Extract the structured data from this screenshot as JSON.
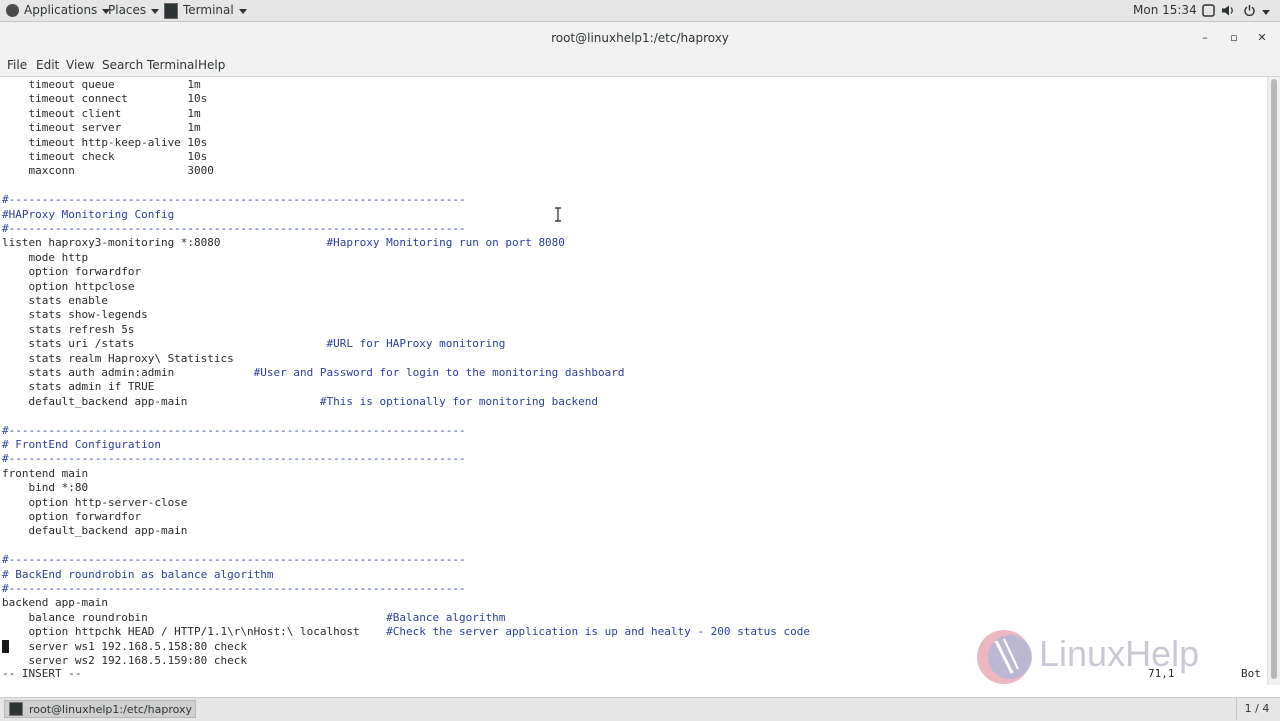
{
  "panel": {
    "applications_label": "Applications",
    "places_label": "Places",
    "taskbar_app_label": "Terminal",
    "clock": "Mon 15:34"
  },
  "window": {
    "title": "root@linuxhelp1:/etc/haproxy",
    "minimize": "–",
    "maximize": "▫",
    "close": "✕"
  },
  "menubar": {
    "items": [
      "File",
      "Edit",
      "View",
      "Search",
      "Terminal",
      "Help"
    ]
  },
  "terminal": {
    "lines": [
      {
        "code": "    timeout queue           1m",
        "comment": ""
      },
      {
        "code": "    timeout connect         10s",
        "comment": ""
      },
      {
        "code": "    timeout client          1m",
        "comment": ""
      },
      {
        "code": "    timeout server          1m",
        "comment": ""
      },
      {
        "code": "    timeout http-keep-alive 10s",
        "comment": ""
      },
      {
        "code": "    timeout check           10s",
        "comment": ""
      },
      {
        "code": "    maxconn                 3000",
        "comment": ""
      },
      {
        "code": "",
        "comment": ""
      },
      {
        "code": "",
        "comment": "#---------------------------------------------------------------------"
      },
      {
        "code": "",
        "comment": "#HAProxy Monitoring Config"
      },
      {
        "code": "",
        "comment": "#---------------------------------------------------------------------"
      },
      {
        "code": "listen haproxy3-monitoring *:8080                ",
        "comment": "#Haproxy Monitoring run on port 8080"
      },
      {
        "code": "    mode http",
        "comment": ""
      },
      {
        "code": "    option forwardfor",
        "comment": ""
      },
      {
        "code": "    option httpclose",
        "comment": ""
      },
      {
        "code": "    stats enable",
        "comment": ""
      },
      {
        "code": "    stats show-legends",
        "comment": ""
      },
      {
        "code": "    stats refresh 5s",
        "comment": ""
      },
      {
        "code": "    stats uri /stats                             ",
        "comment": "#URL for HAProxy monitoring"
      },
      {
        "code": "    stats realm Haproxy\\ Statistics",
        "comment": ""
      },
      {
        "code": "    stats auth admin:admin            ",
        "comment": "#User and Password for login to the monitoring dashboard"
      },
      {
        "code": "    stats admin if TRUE",
        "comment": ""
      },
      {
        "code": "    default_backend app-main                    ",
        "comment": "#This is optionally for monitoring backend"
      },
      {
        "code": "",
        "comment": ""
      },
      {
        "code": "",
        "comment": "#---------------------------------------------------------------------"
      },
      {
        "code": "",
        "comment": "# FrontEnd Configuration"
      },
      {
        "code": "",
        "comment": "#---------------------------------------------------------------------"
      },
      {
        "code": "frontend main",
        "comment": ""
      },
      {
        "code": "    bind *:80",
        "comment": ""
      },
      {
        "code": "    option http-server-close",
        "comment": ""
      },
      {
        "code": "    option forwardfor",
        "comment": ""
      },
      {
        "code": "    default_backend app-main",
        "comment": ""
      },
      {
        "code": "",
        "comment": ""
      },
      {
        "code": "",
        "comment": "#---------------------------------------------------------------------"
      },
      {
        "code": "",
        "comment": "# BackEnd roundrobin as balance algorithm"
      },
      {
        "code": "",
        "comment": "#---------------------------------------------------------------------"
      },
      {
        "code": "backend app-main",
        "comment": ""
      },
      {
        "code": "    balance roundrobin                                    ",
        "comment": "#Balance algorithm"
      },
      {
        "code": "    option httpchk HEAD / HTTP/1.1\\r\\nHost:\\ localhost    ",
        "comment": "#Check the server application is up and healty - 200 status code"
      },
      {
        "code": "    server ws1 192.168.5.158:80 check",
        "comment": ""
      },
      {
        "code": "    server ws2 192.168.5.159:80 check",
        "comment": ""
      }
    ],
    "mode_line": "-- INSERT --",
    "cursor_pos": "71,1",
    "scroll_pos": "Bot"
  },
  "watermark": {
    "brand": "LinuxHelp"
  },
  "taskbar": {
    "window_label": "root@linuxhelp1:/etc/haproxy",
    "workspace": "1 / 4"
  }
}
